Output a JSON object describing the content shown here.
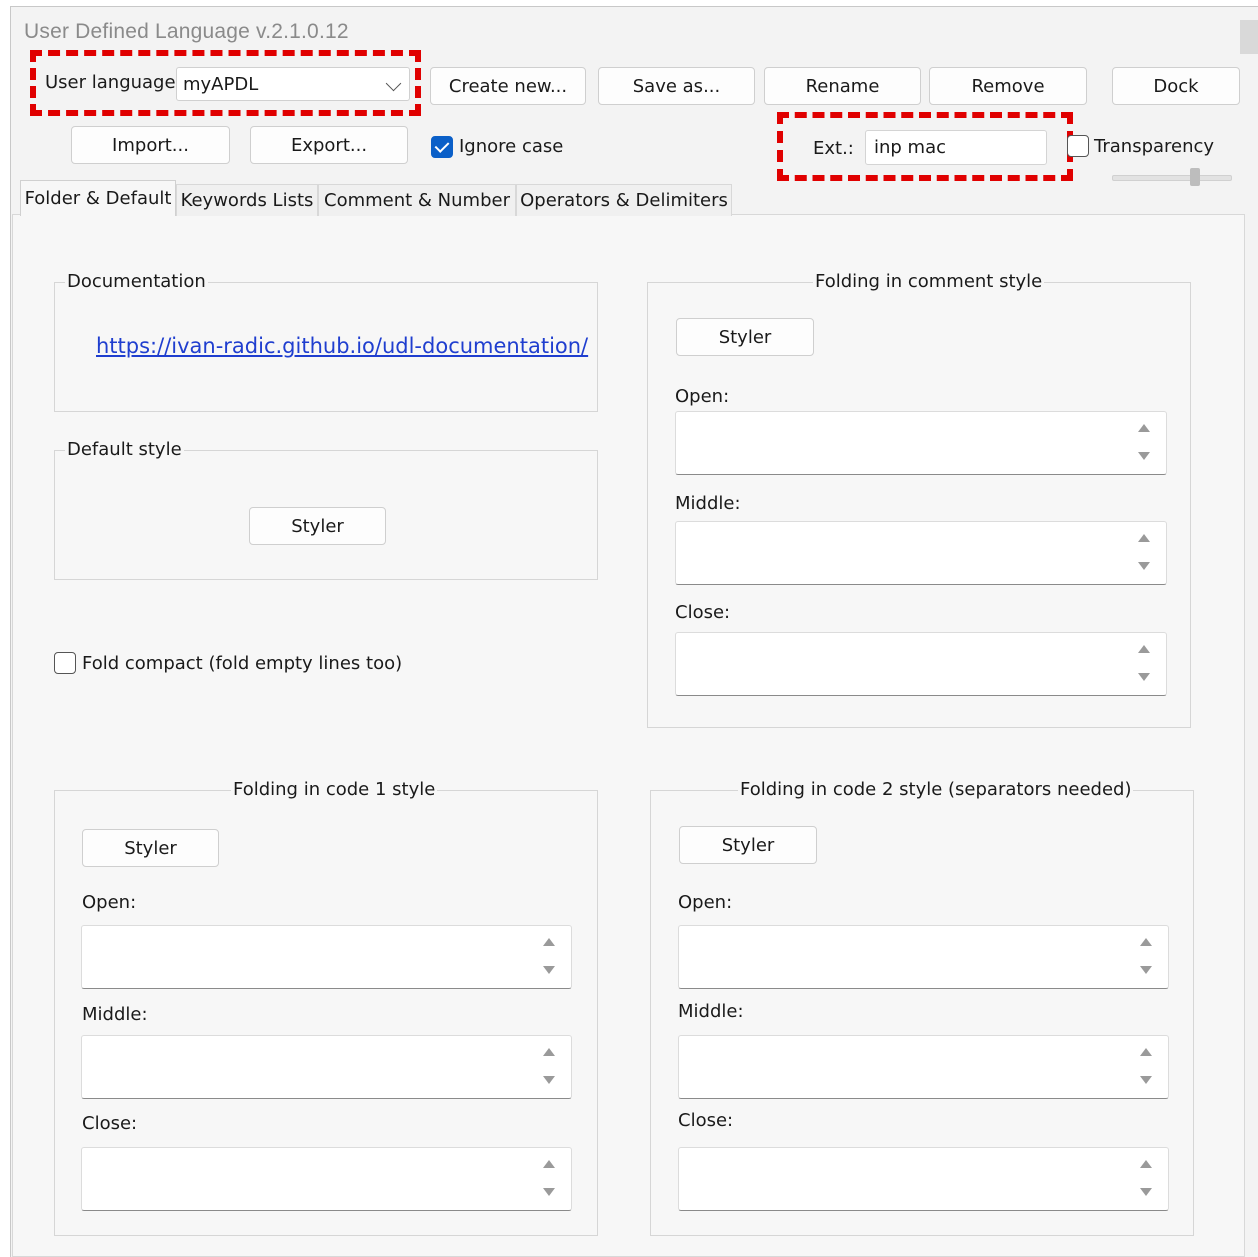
{
  "window": {
    "title": "User Defined Language v.2.1.0.12"
  },
  "toolbar": {
    "user_language_label": "User language:",
    "user_language_value": "myAPDL",
    "create_new": "Create new...",
    "save_as": "Save as...",
    "rename": "Rename",
    "remove": "Remove",
    "dock": "Dock",
    "import": "Import...",
    "export": "Export...",
    "ignore_case_label": "Ignore case",
    "ignore_case_checked": true,
    "ext_label": "Ext.:",
    "ext_value": "inp mac",
    "transparency_label": "Transparency",
    "transparency_checked": false
  },
  "tabs": [
    {
      "label": "Folder & Default",
      "active": true
    },
    {
      "label": "Keywords Lists",
      "active": false
    },
    {
      "label": "Comment & Number",
      "active": false
    },
    {
      "label": "Operators & Delimiters",
      "active": false
    }
  ],
  "documentation": {
    "legend": "Documentation",
    "link": "https://ivan-radic.github.io/udl-documentation/"
  },
  "default_style": {
    "legend": "Default style",
    "styler": "Styler"
  },
  "fold_compact": {
    "label": "Fold compact (fold empty lines too)",
    "checked": false
  },
  "comment_style": {
    "legend": "Folding in comment style",
    "styler": "Styler",
    "open": "Open:",
    "middle": "Middle:",
    "close": "Close:"
  },
  "code1_style": {
    "legend": "Folding in code 1 style",
    "styler": "Styler",
    "open": "Open:",
    "middle": "Middle:",
    "close": "Close:"
  },
  "code2_style": {
    "legend": "Folding in code 2 style (separators needed)",
    "styler": "Styler",
    "open": "Open:",
    "middle": "Middle:",
    "close": "Close:"
  },
  "colors": {
    "highlight": "#e00000",
    "link": "#1f3ecf",
    "checkbox_accent": "#0a5fc8"
  }
}
